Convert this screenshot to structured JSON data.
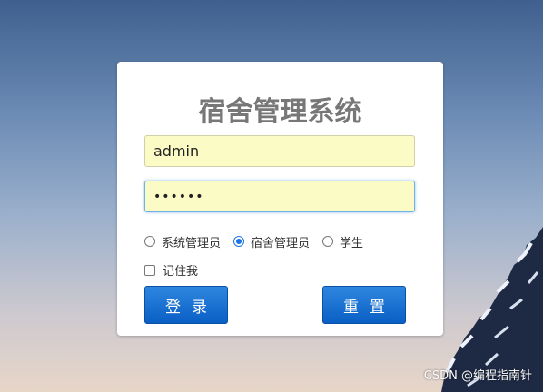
{
  "login": {
    "title": "宿舍管理系统",
    "username_value": "admin",
    "password_value": "••••••",
    "roles": [
      {
        "label": "系统管理员",
        "selected": false
      },
      {
        "label": "宿舍管理员",
        "selected": true
      },
      {
        "label": "学生",
        "selected": false
      }
    ],
    "remember_label": "记住我",
    "remember_checked": false,
    "login_button": "登录",
    "reset_button": "重置"
  },
  "watermark": "CSDN @编程指南针",
  "colors": {
    "primary_button": "#0a5fc4",
    "autofill_bg": "#fbfbc6",
    "title_text": "#777777"
  }
}
